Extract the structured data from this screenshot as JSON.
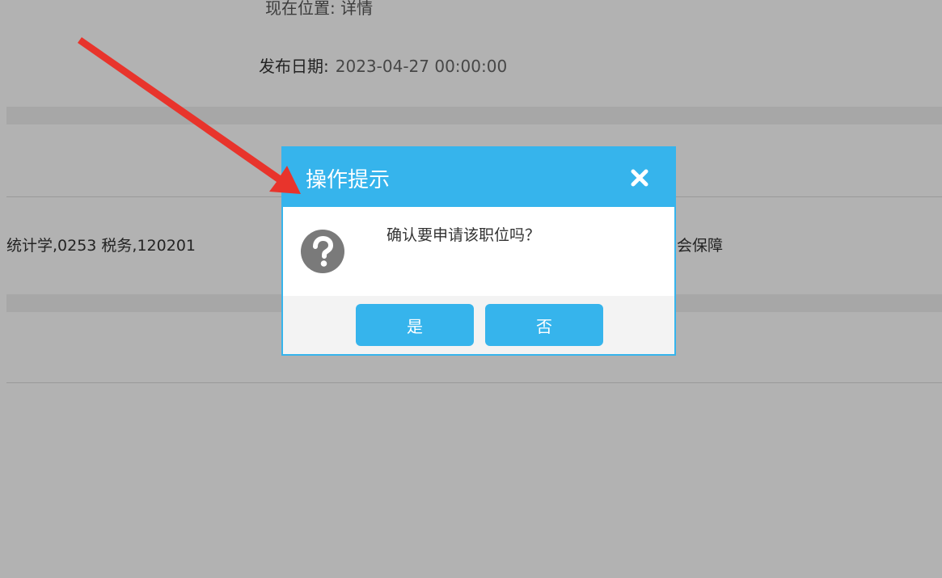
{
  "background": {
    "cut_off_line": "现在位置: 详情",
    "publish_date_label": "发布日期:",
    "publish_date_value": "2023-04-27 00:00:00",
    "majors_left": "统计学,0253 税务,120201",
    "majors_right": "会保障"
  },
  "dialog": {
    "title": "操作提示",
    "close_icon": "close-icon",
    "question_icon": "question-icon",
    "message": "确认要申请该职位吗？",
    "yes_label": "是",
    "no_label": "否"
  },
  "colors": {
    "accent": "#36b4ec",
    "overlay": "rgba(0,0,0,0.30)",
    "annotation_arrow": "#e8342c"
  }
}
